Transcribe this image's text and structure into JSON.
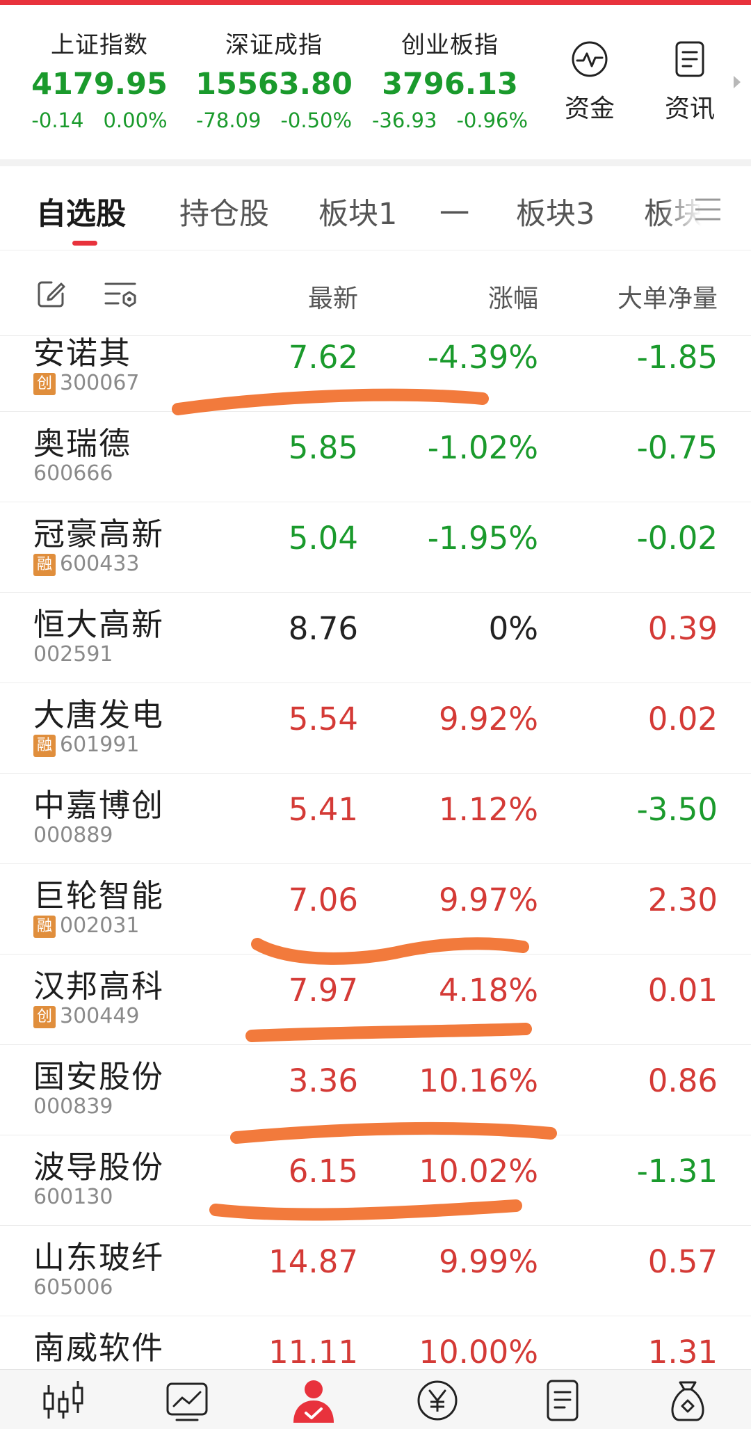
{
  "indices": [
    {
      "name": "上证指数",
      "value": "4179.95",
      "change": "-0.14",
      "pct": "0.00%"
    },
    {
      "name": "深证成指",
      "value": "15563.80",
      "change": "-78.09",
      "pct": "-0.50%"
    },
    {
      "name": "创业板指",
      "value": "3796.13",
      "change": "-36.93",
      "pct": "-0.96%"
    }
  ],
  "header_buttons": {
    "funds": "资金",
    "news": "资讯"
  },
  "tabs": [
    "自选股",
    "持仓股",
    "板块1",
    "一",
    "板块3",
    "板块"
  ],
  "columns": {
    "latest": "最新",
    "change": "涨幅",
    "bigorder": "大单净量"
  },
  "stocks": [
    {
      "name": "安诺其",
      "code": "300067",
      "tag": "创",
      "price": "7.62",
      "pct": "-4.39%",
      "flow": "-1.85"
    },
    {
      "name": "奥瑞德",
      "code": "600666",
      "tag": "",
      "price": "5.85",
      "pct": "-1.02%",
      "flow": "-0.75"
    },
    {
      "name": "冠豪高新",
      "code": "600433",
      "tag": "融",
      "price": "5.04",
      "pct": "-1.95%",
      "flow": "-0.02"
    },
    {
      "name": "恒大高新",
      "code": "002591",
      "tag": "",
      "price": "8.76",
      "pct": "0%",
      "flow": "0.39"
    },
    {
      "name": "大唐发电",
      "code": "601991",
      "tag": "融",
      "price": "5.54",
      "pct": "9.92%",
      "flow": "0.02"
    },
    {
      "name": "中嘉博创",
      "code": "000889",
      "tag": "",
      "price": "5.41",
      "pct": "1.12%",
      "flow": "-3.50"
    },
    {
      "name": "巨轮智能",
      "code": "002031",
      "tag": "融",
      "price": "7.06",
      "pct": "9.97%",
      "flow": "2.30"
    },
    {
      "name": "汉邦高科",
      "code": "300449",
      "tag": "创",
      "price": "7.97",
      "pct": "4.18%",
      "flow": "0.01"
    },
    {
      "name": "国安股份",
      "code": "000839",
      "tag": "",
      "price": "3.36",
      "pct": "10.16%",
      "flow": "0.86"
    },
    {
      "name": "波导股份",
      "code": "600130",
      "tag": "",
      "price": "6.15",
      "pct": "10.02%",
      "flow": "-1.31"
    },
    {
      "name": "山东玻纤",
      "code": "605006",
      "tag": "",
      "price": "14.87",
      "pct": "9.99%",
      "flow": "0.57"
    },
    {
      "name": "南威软件",
      "code": "",
      "tag": "",
      "price": "11.11",
      "pct": "10.00%",
      "flow": "1.31"
    }
  ],
  "colors": {
    "up": "#d43a36",
    "down": "#1a9a2c",
    "accent": "#e8323c",
    "highlight": "#f27a3c",
    "tag": "#e08e3c"
  },
  "bottom_nav_icons": [
    "candlestick-icon",
    "chart-icon",
    "user-icon",
    "yuan-icon",
    "document-icon",
    "money-bag-icon"
  ]
}
